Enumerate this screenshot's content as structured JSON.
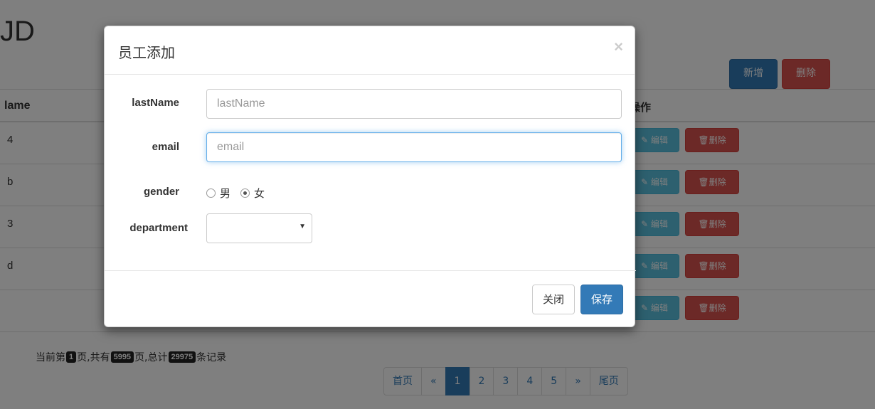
{
  "page": {
    "title_fragment": "JD",
    "add_label": "新增",
    "delete_label": "删除",
    "table": {
      "col_name_fragment": "lame",
      "col_ops": "操作",
      "rows": [
        {
          "name": "4",
          "edit": "编辑",
          "delete": "删除"
        },
        {
          "name": "b",
          "edit": "编辑",
          "delete": "删除"
        },
        {
          "name": "3",
          "edit": "编辑",
          "delete": "删除"
        },
        {
          "name": "d",
          "edit": "编辑",
          "delete": "删除"
        },
        {
          "name": "",
          "edit": "编辑",
          "delete": "删除"
        }
      ]
    },
    "pager": {
      "prefix": "当前第",
      "current": "1",
      "mid1": "页,共有",
      "total_pages": "5995",
      "mid2": " 页,总计",
      "total_records": "29975",
      "suffix": "条记录"
    },
    "pagination": [
      "首页",
      "«",
      "1",
      "2",
      "3",
      "4",
      "5",
      "»",
      "尾页"
    ],
    "pagination_active": "1"
  },
  "modal": {
    "title": "员工添加",
    "close_symbol": "×",
    "fields": {
      "lastName": {
        "label": "lastName",
        "placeholder": "lastName",
        "value": ""
      },
      "email": {
        "label": "email",
        "placeholder": "email",
        "value": ""
      },
      "gender": {
        "label": "gender",
        "options": [
          "男",
          "女"
        ],
        "selected": "女"
      },
      "department": {
        "label": "department",
        "value": ""
      }
    },
    "close_label": "关闭",
    "save_label": "保存"
  },
  "colors": {
    "primary": "#337ab7",
    "danger": "#d9534f",
    "info": "#5bc0de",
    "backdrop": "rgba(0,0,0,0.5)"
  }
}
